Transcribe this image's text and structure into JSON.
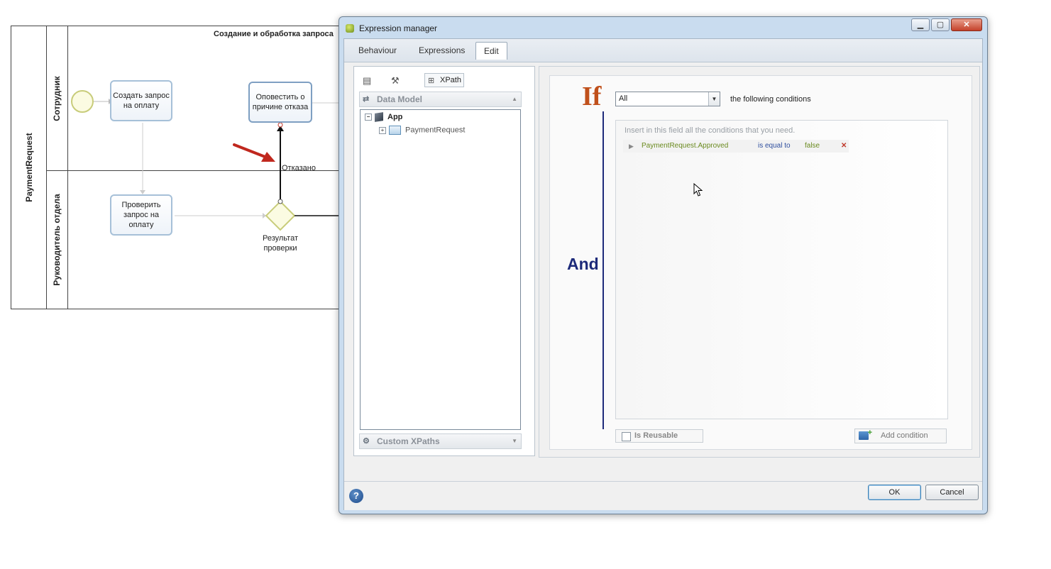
{
  "diagram": {
    "pool_label": "PaymentRequest",
    "pool_title": "Создание  и обработка  запроса",
    "lanes": [
      "Сотрудник",
      "Руководитель отдела"
    ],
    "tasks": {
      "create": "Создать запрос на оплату",
      "notify": "Оповестить о причине отказа",
      "review": "Проверить запрос на оплату"
    },
    "gateway_label": "Результат проверки",
    "flow_label": "Отказано"
  },
  "dialog": {
    "title": "Expression manager",
    "tabs": [
      "Behaviour",
      "Expressions",
      "Edit"
    ],
    "active_tab": "Edit",
    "left": {
      "xpath_label": "XPath",
      "data_model_label": "Data Model",
      "tree_root": "App",
      "tree_child": "PaymentRequest",
      "custom_xpaths_label": "Custom XPaths"
    },
    "right": {
      "if_word": "If",
      "and_word": "And",
      "quantifier": "All",
      "following_text": "the following conditions",
      "hint": "Insert in this field all the conditions that you need.",
      "condition": {
        "field": "PaymentRequest.Approved",
        "operator": "is equal to",
        "value": "false"
      },
      "is_reusable_label": "Is Reusable",
      "add_condition_label": "Add condition"
    },
    "buttons": {
      "ok": "OK",
      "cancel": "Cancel",
      "help": "?"
    }
  }
}
